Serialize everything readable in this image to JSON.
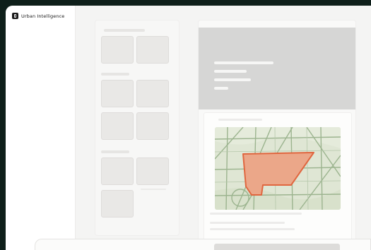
{
  "app": {
    "name": "Urban Intelligence",
    "logo_icon": "urban-intelligence-logo-icon"
  },
  "colors": {
    "window_background": "#0e1f1a",
    "canvas": "#f4f4f3",
    "map_land": "#dfe6d4",
    "map_roads": "#9cb48f",
    "parcel_fill": "#eba789",
    "parcel_stroke": "#e0663f"
  },
  "preview": {
    "map_icon": "site-map-with-highlighted-parcel"
  }
}
